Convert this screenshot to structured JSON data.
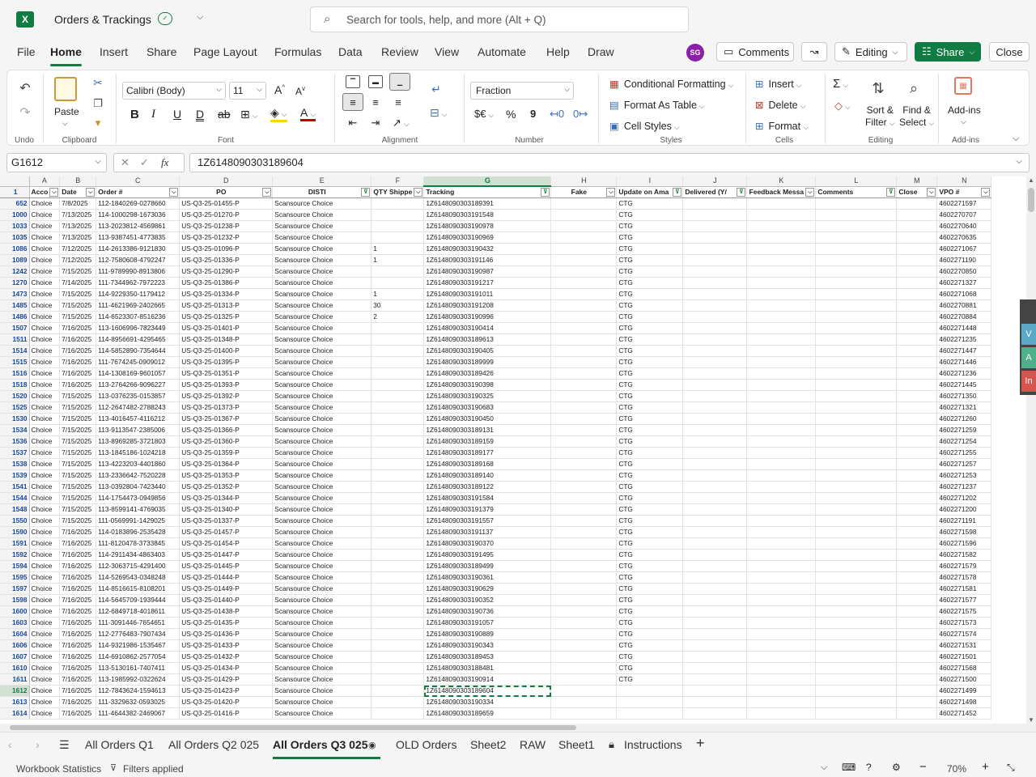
{
  "title_bar": {
    "doc_title": "Orders & Trackings",
    "search_placeholder": "Search for tools, help, and more (Alt + Q)"
  },
  "menu": [
    "File",
    "Home",
    "Insert",
    "Share",
    "Page Layout",
    "Formulas",
    "Data",
    "Review",
    "View",
    "Automate",
    "Help",
    "Draw"
  ],
  "menu_active": "Home",
  "account": {
    "initials": "SG"
  },
  "top_buttons": {
    "comments": "Comments",
    "editing": "Editing",
    "share": "Share",
    "close": "Close"
  },
  "ribbon": {
    "undo_label": "Undo",
    "clipboard": {
      "paste": "Paste",
      "label": "Clipboard"
    },
    "font": {
      "name": "Calibri (Body)",
      "size": "11",
      "label": "Font"
    },
    "alignment": {
      "label": "Alignment"
    },
    "number": {
      "format": "Fraction",
      "currency": "$€",
      "percent": "%",
      "comma": "9",
      "label": "Number"
    },
    "styles": {
      "conditional": "Conditional Formatting",
      "format_table": "Format As Table",
      "cell_styles": "Cell Styles",
      "label": "Styles"
    },
    "cells": {
      "insert": "Insert",
      "delete": "Delete",
      "format": "Format",
      "label": "Cells"
    },
    "editing": {
      "sigma": "Σ",
      "sort1": "Sort &",
      "sort2": "Filter",
      "find1": "Find &",
      "find2": "Select",
      "label": "Editing"
    },
    "addins": {
      "name": "Add-ins",
      "label": "Add-ins"
    }
  },
  "formula_bar": {
    "name_box": "G1612",
    "fx": "fx",
    "formula": "1Z6148090303189604"
  },
  "columns": [
    "A",
    "B",
    "C",
    "D",
    "E",
    "F",
    "G",
    "H",
    "I",
    "J",
    "K",
    "L",
    "M",
    "N"
  ],
  "header_row_num": "1",
  "headers": [
    "Acco",
    "Date",
    "Order #",
    "PO",
    "DISTI",
    "QTY Shippe",
    "Tracking",
    "Fake",
    "Update on Ama",
    "Delivered (Y/",
    "Feedback Messa",
    "Comments",
    "Close",
    "VPO #"
  ],
  "rows": [
    [
      "652",
      "Choice",
      "7/8/2025",
      "112-1840269-0278660",
      "US-Q3-25-01455-P",
      "Scansource Choice",
      "",
      "1Z6148090303189391",
      "",
      "CTG",
      "",
      "",
      "",
      "",
      "4602271597"
    ],
    [
      "1000",
      "Choice",
      "7/13/2025",
      "114-1000298-1673036",
      "US-Q3-25-01270-P",
      "Scansource Choice",
      "",
      "1Z6148090303191548",
      "",
      "CTG",
      "",
      "",
      "",
      "",
      "4602270707"
    ],
    [
      "1033",
      "Choice",
      "7/13/2025",
      "113-2023812-4569861",
      "US-Q3-25-01238-P",
      "Scansource Choice",
      "",
      "1Z6148090303190978",
      "",
      "CTG",
      "",
      "",
      "",
      "",
      "4602270640"
    ],
    [
      "1035",
      "Choice",
      "7/13/2025",
      "113-9387451-4773835",
      "US-Q3-25-01232-P",
      "Scansource Choice",
      "",
      "1Z6148090303190969",
      "",
      "CTG",
      "",
      "",
      "",
      "",
      "4602270635"
    ],
    [
      "1086",
      "Choice",
      "7/12/2025",
      "114-2613386-9121830",
      "US-Q3-25-01096-P",
      "Scansource Choice",
      "1",
      "1Z6148090303190432",
      "",
      "CTG",
      "",
      "",
      "",
      "",
      "4602271067"
    ],
    [
      "1089",
      "Choice",
      "7/12/2025",
      "112-7580608-4792247",
      "US-Q3-25-01336-P",
      "Scansource Choice",
      "1",
      "1Z6148090303191146",
      "",
      "CTG",
      "",
      "",
      "",
      "",
      "4602271190"
    ],
    [
      "1242",
      "Choice",
      "7/15/2025",
      "111-9789990-8913806",
      "US-Q3-25-01290-P",
      "Scansource Choice",
      "",
      "1Z6148090303190987",
      "",
      "CTG",
      "",
      "",
      "",
      "",
      "4602270850"
    ],
    [
      "1270",
      "Choice",
      "7/14/2025",
      "111-7344962-7972223",
      "US-Q3-25-01386-P",
      "Scansource Choice",
      "",
      "1Z6148090303191217",
      "",
      "CTG",
      "",
      "",
      "",
      "",
      "4602271327"
    ],
    [
      "1473",
      "Choice",
      "7/15/2025",
      "114-9229350-1179412",
      "US-Q3-25-01334-P",
      "Scansource Choice",
      "1",
      "1Z6148090303191011",
      "",
      "CTG",
      "",
      "",
      "",
      "",
      "4602271068"
    ],
    [
      "1485",
      "Choice",
      "7/15/2025",
      "111-4621969-2402665",
      "US-Q3-25-01313-P",
      "Scansource Choice",
      "30",
      "1Z6148090303191208",
      "",
      "CTG",
      "",
      "",
      "",
      "",
      "4602270881"
    ],
    [
      "1486",
      "Choice",
      "7/15/2025",
      "114-6523307-8516236",
      "US-Q3-25-01325-P",
      "Scansource Choice",
      "2",
      "1Z6148090303190996",
      "",
      "CTG",
      "",
      "",
      "",
      "",
      "4602270884"
    ],
    [
      "1507",
      "Choice",
      "7/16/2025",
      "113-1606996-7823449",
      "US-Q3-25-01401-P",
      "Scansource Choice",
      "",
      "1Z6148090303190414",
      "",
      "CTG",
      "",
      "",
      "",
      "",
      "4602271448"
    ],
    [
      "1511",
      "Choice",
      "7/16/2025",
      "114-8956691-4295465",
      "US-Q3-25-01348-P",
      "Scansource Choice",
      "",
      "1Z6148090303189613",
      "",
      "CTG",
      "",
      "",
      "",
      "",
      "4602271235"
    ],
    [
      "1514",
      "Choice",
      "7/16/2025",
      "114-5852890-7354644",
      "US-Q3-25-01400-P",
      "Scansource Choice",
      "",
      "1Z6148090303190405",
      "",
      "CTG",
      "",
      "",
      "",
      "",
      "4602271447"
    ],
    [
      "1515",
      "Choice",
      "7/16/2025",
      "111-7674245-0909012",
      "US-Q3-25-01395-P",
      "Scansource Choice",
      "",
      "1Z6148090303189999",
      "",
      "CTG",
      "",
      "",
      "",
      "",
      "4602271446"
    ],
    [
      "1516",
      "Choice",
      "7/16/2025",
      "114-1308169-9601057",
      "US-Q3-25-01351-P",
      "Scansource Choice",
      "",
      "1Z6148090303189426",
      "",
      "CTG",
      "",
      "",
      "",
      "",
      "4602271236"
    ],
    [
      "1518",
      "Choice",
      "7/16/2025",
      "113-2764266-9096227",
      "US-Q3-25-01393-P",
      "Scansource Choice",
      "",
      "1Z6148090303190398",
      "",
      "CTG",
      "",
      "",
      "",
      "",
      "4602271445"
    ],
    [
      "1520",
      "Choice",
      "7/15/2025",
      "113-0376235-0153857",
      "US-Q3-25-01392-P",
      "Scansource Choice",
      "",
      "1Z6148090303190325",
      "",
      "CTG",
      "",
      "",
      "",
      "",
      "4602271350"
    ],
    [
      "1525",
      "Choice",
      "7/15/2025",
      "112-2647482-2788243",
      "US-Q3-25-01373-P",
      "Scansource Choice",
      "",
      "1Z6148090303190683",
      "",
      "CTG",
      "",
      "",
      "",
      "",
      "4602271321"
    ],
    [
      "1530",
      "Choice",
      "7/15/2025",
      "113-4016457-4116212",
      "US-Q3-25-01367-P",
      "Scansource Choice",
      "",
      "1Z6148090303190450",
      "",
      "CTG",
      "",
      "",
      "",
      "",
      "4602271260"
    ],
    [
      "1534",
      "Choice",
      "7/15/2025",
      "113-9113547-2385006",
      "US-Q3-25-01366-P",
      "Scansource Choice",
      "",
      "1Z6148090303189131",
      "",
      "CTG",
      "",
      "",
      "",
      "",
      "4602271259"
    ],
    [
      "1536",
      "Choice",
      "7/15/2025",
      "113-8969285-3721803",
      "US-Q3-25-01360-P",
      "Scansource Choice",
      "",
      "1Z6148090303189159",
      "",
      "CTG",
      "",
      "",
      "",
      "",
      "4602271254"
    ],
    [
      "1537",
      "Choice",
      "7/15/2025",
      "113-1845186-1024218",
      "US-Q3-25-01359-P",
      "Scansource Choice",
      "",
      "1Z6148090303189177",
      "",
      "CTG",
      "",
      "",
      "",
      "",
      "4602271255"
    ],
    [
      "1538",
      "Choice",
      "7/15/2025",
      "113-4223203-4401860",
      "US-Q3-25-01364-P",
      "Scansource Choice",
      "",
      "1Z6148090303189168",
      "",
      "CTG",
      "",
      "",
      "",
      "",
      "4602271257"
    ],
    [
      "1539",
      "Choice",
      "7/15/2025",
      "113-2336642-7520228",
      "US-Q3-25-01353-P",
      "Scansource Choice",
      "",
      "1Z6148090303189140",
      "",
      "CTG",
      "",
      "",
      "",
      "",
      "4602271253"
    ],
    [
      "1541",
      "Choice",
      "7/15/2025",
      "113-0392804-7423440",
      "US-Q3-25-01352-P",
      "Scansource Choice",
      "",
      "1Z6148090303189122",
      "",
      "CTG",
      "",
      "",
      "",
      "",
      "4602271237"
    ],
    [
      "1544",
      "Choice",
      "7/15/2025",
      "114-1754473-0949856",
      "US-Q3-25-01344-P",
      "Scansource Choice",
      "",
      "1Z6148090303191584",
      "",
      "CTG",
      "",
      "",
      "",
      "",
      "4602271202"
    ],
    [
      "1548",
      "Choice",
      "7/15/2025",
      "113-8599141-4769035",
      "US-Q3-25-01340-P",
      "Scansource Choice",
      "",
      "1Z6148090303191379",
      "",
      "CTG",
      "",
      "",
      "",
      "",
      "4602271200"
    ],
    [
      "1550",
      "Choice",
      "7/15/2025",
      "111-0569991-1429025",
      "US-Q3-25-01337-P",
      "Scansource Choice",
      "",
      "1Z6148090303191557",
      "",
      "CTG",
      "",
      "",
      "",
      "",
      "4602271191"
    ],
    [
      "1590",
      "Choice",
      "7/16/2025",
      "114-0183896-2535428",
      "US-Q3-25-01457-P",
      "Scansource Choice",
      "",
      "1Z6148090303191137",
      "",
      "CTG",
      "",
      "",
      "",
      "",
      "4602271598"
    ],
    [
      "1591",
      "Choice",
      "7/16/2025",
      "111-8120478-3733845",
      "US-Q3-25-01454-P",
      "Scansource Choice",
      "",
      "1Z6148090303190370",
      "",
      "CTG",
      "",
      "",
      "",
      "",
      "4602271596"
    ],
    [
      "1592",
      "Choice",
      "7/16/2025",
      "114-2911434-4863403",
      "US-Q3-25-01447-P",
      "Scansource Choice",
      "",
      "1Z6148090303191495",
      "",
      "CTG",
      "",
      "",
      "",
      "",
      "4602271582"
    ],
    [
      "1594",
      "Choice",
      "7/16/2025",
      "112-3063715-4291400",
      "US-Q3-25-01445-P",
      "Scansource Choice",
      "",
      "1Z6148090303189499",
      "",
      "CTG",
      "",
      "",
      "",
      "",
      "4602271579"
    ],
    [
      "1595",
      "Choice",
      "7/16/2025",
      "114-5269543-0348248",
      "US-Q3-25-01444-P",
      "Scansource Choice",
      "",
      "1Z6148090303190361",
      "",
      "CTG",
      "",
      "",
      "",
      "",
      "4602271578"
    ],
    [
      "1597",
      "Choice",
      "7/16/2025",
      "114-8516615-8108201",
      "US-Q3-25-01449-P",
      "Scansource Choice",
      "",
      "1Z6148090303190629",
      "",
      "CTG",
      "",
      "",
      "",
      "",
      "4602271581"
    ],
    [
      "1598",
      "Choice",
      "7/16/2025",
      "114-5645709-1939444",
      "US-Q3-25-01440-P",
      "Scansource Choice",
      "",
      "1Z6148090303190352",
      "",
      "CTG",
      "",
      "",
      "",
      "",
      "4602271577"
    ],
    [
      "1600",
      "Choice",
      "7/16/2025",
      "112-6849718-4018611",
      "US-Q3-25-01438-P",
      "Scansource Choice",
      "",
      "1Z6148090303190736",
      "",
      "CTG",
      "",
      "",
      "",
      "",
      "4602271575"
    ],
    [
      "1603",
      "Choice",
      "7/16/2025",
      "111-3091446-7654651",
      "US-Q3-25-01435-P",
      "Scansource Choice",
      "",
      "1Z6148090303191057",
      "",
      "CTG",
      "",
      "",
      "",
      "",
      "4602271573"
    ],
    [
      "1604",
      "Choice",
      "7/16/2025",
      "112-2776483-7907434",
      "US-Q3-25-01436-P",
      "Scansource Choice",
      "",
      "1Z6148090303190889",
      "",
      "CTG",
      "",
      "",
      "",
      "",
      "4602271574"
    ],
    [
      "1606",
      "Choice",
      "7/16/2025",
      "114-9321986-1535467",
      "US-Q3-25-01433-P",
      "Scansource Choice",
      "",
      "1Z6148090303190343",
      "",
      "CTG",
      "",
      "",
      "",
      "",
      "4602271531"
    ],
    [
      "1607",
      "Choice",
      "7/16/2025",
      "114-6910862-2577054",
      "US-Q3-25-01432-P",
      "Scansource Choice",
      "",
      "1Z6148090303189453",
      "",
      "CTG",
      "",
      "",
      "",
      "",
      "4602271501"
    ],
    [
      "1610",
      "Choice",
      "7/16/2025",
      "113-5130161-7407411",
      "US-Q3-25-01434-P",
      "Scansource Choice",
      "",
      "1Z6148090303188481",
      "",
      "CTG",
      "",
      "",
      "",
      "",
      "4602271568"
    ],
    [
      "1611",
      "Choice",
      "7/16/2025",
      "113-1985992-0322624",
      "US-Q3-25-01429-P",
      "Scansource Choice",
      "",
      "1Z6148090303190914",
      "",
      "CTG",
      "",
      "",
      "",
      "",
      "4602271500"
    ],
    [
      "1612",
      "Choice",
      "7/16/2025",
      "112-7843624-1594613",
      "US-Q3-25-01423-P",
      "Scansource Choice",
      "",
      "1Z6148090303189604",
      "",
      "",
      "",
      "",
      "",
      "",
      "4602271499"
    ],
    [
      "1613",
      "Choice",
      "7/16/2025",
      "111-3329632-0593025",
      "US-Q3-25-01420-P",
      "Scansource Choice",
      "",
      "1Z6148090303190334",
      "",
      "",
      "",
      "",
      "",
      "",
      "4602271498"
    ],
    [
      "1614",
      "Choice",
      "7/16/2025",
      "111-4644382-2469067",
      "US-Q3-25-01416-P",
      "Scansource Choice",
      "",
      "1Z6148090303189659",
      "",
      "",
      "",
      "",
      "",
      "",
      "4602271452"
    ]
  ],
  "selected_row": "1612",
  "sheet_tabs": [
    "All Orders Q1",
    "All Orders Q2 025",
    "All Orders Q3 025",
    "OLD Orders",
    "Sheet2",
    "RAW",
    "Sheet1",
    "Instructions"
  ],
  "active_tab": "All Orders Q3 025",
  "status": {
    "workbook_stats": "Workbook Statistics",
    "filters": "Filters applied",
    "zoom": "70%"
  },
  "side_tabs": [
    "V",
    "A",
    "In"
  ]
}
